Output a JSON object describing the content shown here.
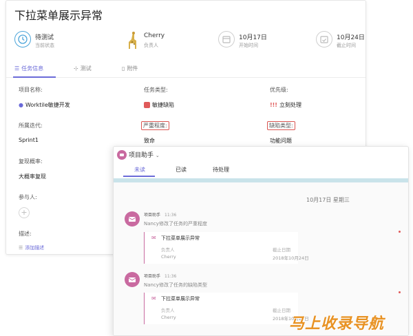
{
  "task": {
    "title": "下拉菜单展示异常",
    "stats": [
      {
        "value": "待测试",
        "sub": "当前状态",
        "icon": "clock-icon"
      },
      {
        "value": "Cherry",
        "sub": "负责人",
        "icon": "giraffe-avatar"
      },
      {
        "value": "10月17日",
        "sub": "开始时间",
        "icon": "calendar-icon"
      },
      {
        "value": "10月24日",
        "sub": "截止时间",
        "icon": "calendar-check-icon"
      }
    ],
    "tabs": [
      {
        "label": "任务信息",
        "icon": "list-icon",
        "active": true
      },
      {
        "label": "测试",
        "icon": "test-icon",
        "active": false
      },
      {
        "label": "附件",
        "icon": "file-icon",
        "active": false
      }
    ],
    "fields": {
      "project_label": "项目名称:",
      "project_value": "Worktile敏捷开发",
      "type_label": "任务类型:",
      "type_value": "敏捷缺陷",
      "priority_label": "优先级:",
      "priority_value": "立刻处理",
      "priority_mark": "!!!",
      "iteration_label": "所属迭代:",
      "iteration_value": "Sprint1",
      "severity_label": "严重程度:",
      "severity_value": "致命",
      "defect_label": "缺陷类型:",
      "defect_value": "功能问题",
      "repro_label": "复现概率:",
      "repro_value": "大概率复现",
      "participants_label": "参与人:",
      "desc_label": "描述:",
      "desc_add": "添加描述"
    }
  },
  "notification": {
    "title": "项目助手",
    "tabs": [
      "未读",
      "已读",
      "待处理"
    ],
    "date": "10月17日 星期三",
    "messages": [
      {
        "sender": "项目助手",
        "time": "11:36",
        "text": "Nancy修改了任务的严重程度",
        "card_title": "下拉菜单展示异常",
        "owner_label": "负责人",
        "owner": "Cherry",
        "due_label": "截止日期",
        "due": "2018年10月24日"
      },
      {
        "sender": "项目助手",
        "time": "11:36",
        "text": "Nancy修改了任务的缺陷类型",
        "card_title": "下拉菜单展示异常",
        "owner_label": "负责人",
        "owner": "Cherry",
        "due_label": "截止日期",
        "due": "2018年10月24日"
      }
    ]
  },
  "watermark": "马上收录导航",
  "colors": {
    "accent": "#6a6ad8",
    "highlight": "#d9534f",
    "bot": "#c96aa0",
    "bar": "#c9e3ea"
  }
}
